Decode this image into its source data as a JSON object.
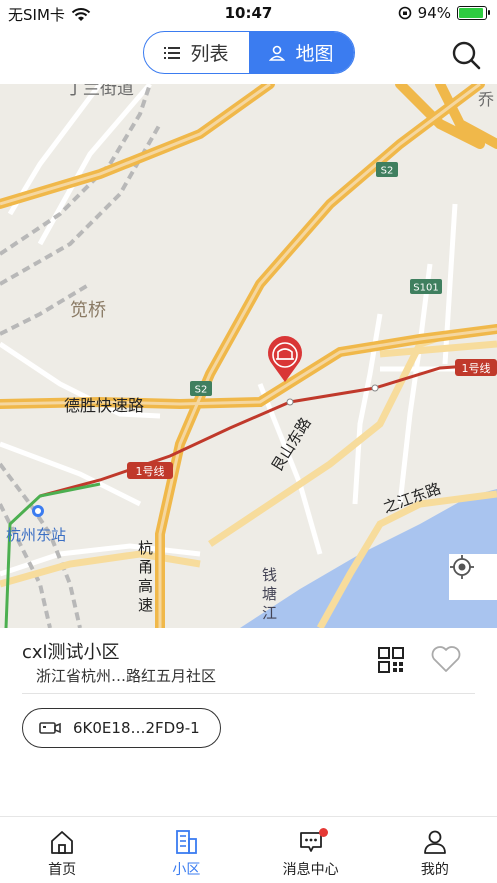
{
  "status_bar": {
    "carrier": "无SIM卡",
    "time": "10:47",
    "battery_percent": "94%",
    "battery_level": 0.94,
    "icons": [
      "wifi-icon",
      "orientation-lock-icon",
      "battery-icon"
    ]
  },
  "header": {
    "tabs": [
      {
        "label": "列表",
        "icon": "list-icon",
        "active": false
      },
      {
        "label": "地图",
        "icon": "person-icon",
        "active": true
      }
    ],
    "search_icon": "search-icon"
  },
  "map": {
    "labels": {
      "district": "笕桥",
      "expressway": "德胜快速路",
      "station": "杭州东站",
      "road_genshan": "艮山东路",
      "road_zhijiang": "之江东路",
      "road_hangyong": "杭甬高速",
      "river": "钱塘江",
      "top_road": "丁兰街道",
      "top_right": "乔"
    },
    "shields": {
      "s2_top": "S2",
      "s2_mid": "S2",
      "s101": "S101",
      "metro_right": "1号线",
      "metro_left": "1号线"
    },
    "marker_icon": "community-marker-icon",
    "locate_icon": "locate-icon"
  },
  "card": {
    "title": "cxl测试小区",
    "address": "浙江省杭州…路红五月社区",
    "device_id": "6K0E18…2FD9-1",
    "icons": [
      "qr-code-icon",
      "heart-icon",
      "camera-icon"
    ]
  },
  "tabbar": {
    "items": [
      {
        "label": "首页",
        "icon": "home-icon",
        "active": false
      },
      {
        "label": "小区",
        "icon": "community-icon",
        "active": true
      },
      {
        "label": "消息中心",
        "icon": "message-icon",
        "active": false,
        "badge": true
      },
      {
        "label": "我的",
        "icon": "user-icon",
        "active": false
      }
    ]
  },
  "colors": {
    "accent": "#3b7cf0",
    "map_bg": "#eeece6",
    "highway": "#f0b84a",
    "metro": "#c0392b",
    "river": "#a9c4ef",
    "marker": "#d93636"
  }
}
